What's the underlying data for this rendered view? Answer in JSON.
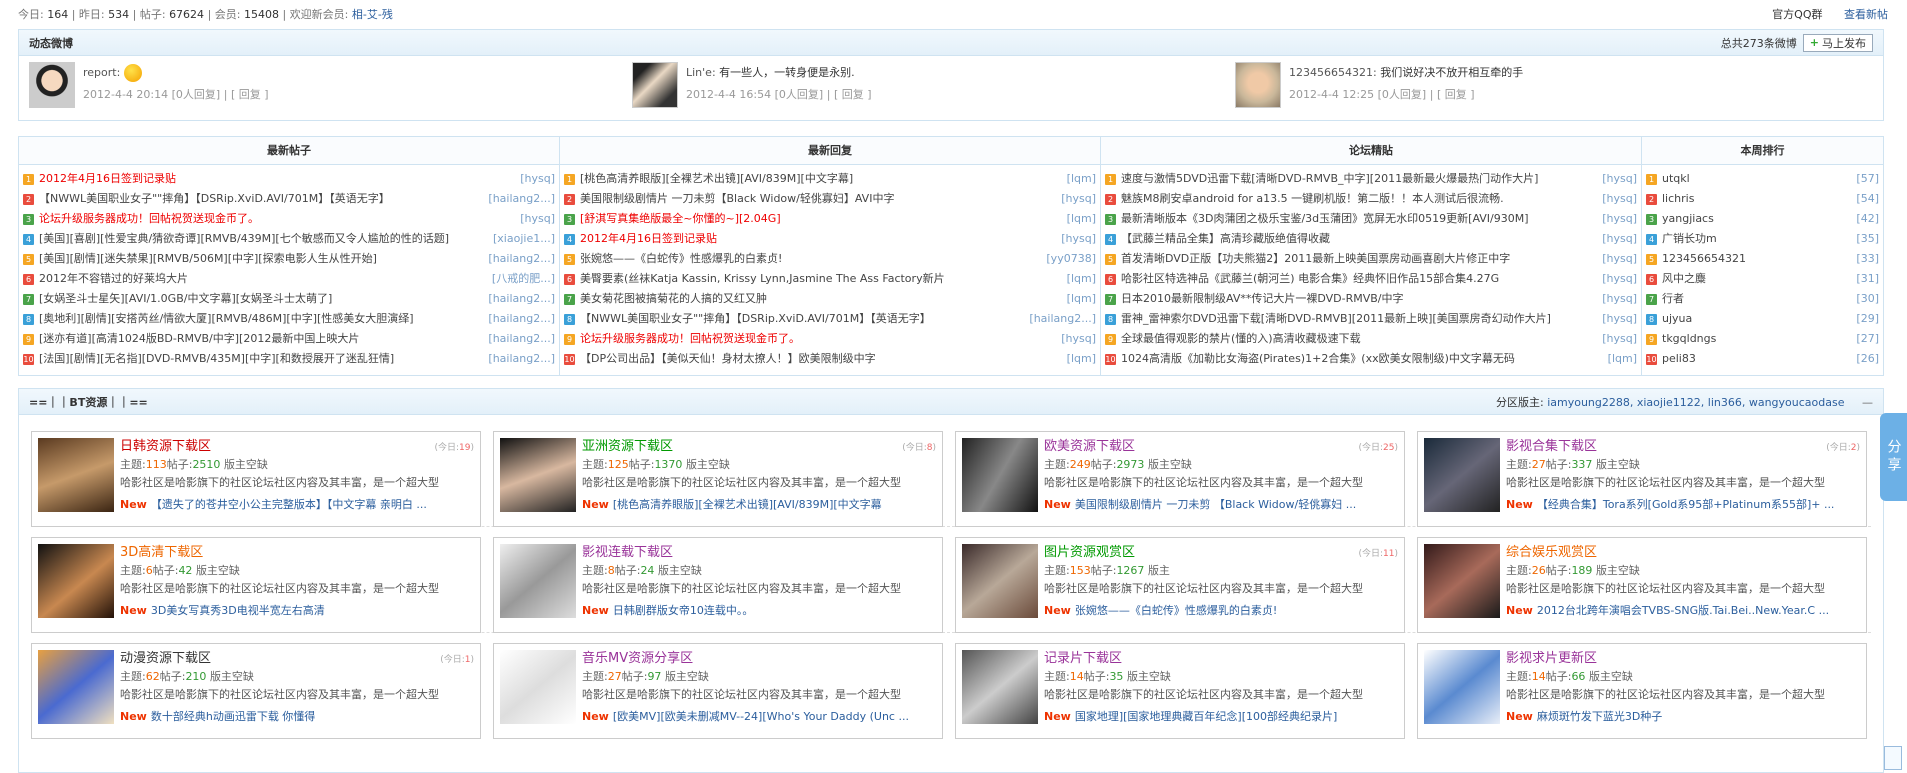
{
  "topbar": {
    "today_label": "今日:",
    "today": "164",
    "yesterday_label": "昨日:",
    "yesterday": "534",
    "posts_label": "帖子:",
    "posts": "67624",
    "members_label": "会员:",
    "members": "15408",
    "welcome_label": "欢迎新会员:",
    "new_member": "相-艾-残",
    "qq_group": "官方QQ群",
    "view_new": "查看新帖"
  },
  "feed": {
    "title": "动态微博",
    "total": "总共273条微博",
    "publish": "马上发布",
    "items": [
      {
        "user": "report:",
        "text": "",
        "time": "2012-4-4 20:14",
        "replies": "[0人回复]",
        "reply": "[ 回复 ]"
      },
      {
        "user": "Lin'e:",
        "text": "有一些人，一转身便是永别.",
        "time": "2012-4-4 16:54",
        "replies": "[0人回复]",
        "reply": "[ 回复 ]"
      },
      {
        "user": "123456654321:",
        "text": "我们说好决不放开相互牵的手",
        "time": "2012-4-4 12:25",
        "replies": "[0人回复]",
        "reply": "[ 回复 ]"
      }
    ]
  },
  "columns": [
    {
      "title": "最新帖子",
      "items": [
        {
          "t": "2012年4月16日签到记录贴",
          "a": "[hysq]",
          "red": true
        },
        {
          "t": "【NWWL美国职业女子\"\"摔角】【DSRip.XviD.AVI/701M】【英语无字】",
          "a": "[hailang2...]",
          "red": false
        },
        {
          "t": "论坛升级服务器成功！回帖祝贺送现金币了。",
          "a": "[hysq]",
          "red": true
        },
        {
          "t": "[美国][喜剧][性爱宝典/猜欲奇谭][RMVB/439M][七个敏感而又令人尴尬的性的话题]",
          "a": "[xiaojie1...]",
          "red": false
        },
        {
          "t": "[美国][剧情][迷失禁果][RMVB/506M][中字][探索电影人生从性开始]",
          "a": "[hailang2...]",
          "red": false
        },
        {
          "t": "2012年不容错过的好莱坞大片",
          "a": "[八戒的肥...]",
          "red": false
        },
        {
          "t": "[女娲圣斗士星矢][AVI/1.0GB/中文字幕][女娲圣斗士太萌了]",
          "a": "[hailang2...]",
          "red": false
        },
        {
          "t": "[奥地利][剧情][安搭芮丝/情欲大厦][RMVB/486M][中字][性感美女大胆演绎]",
          "a": "[hailang2...]",
          "red": false
        },
        {
          "t": "[迷亦有道][高清1024版BD-RMVB/中字][2012最新中国上映大片",
          "a": "[hailang2...]",
          "red": false
        },
        {
          "t": "[法国][剧情][无名指][DVD-RMVB/435M][中字][和数授展开了迷乱狂情]",
          "a": "[hailang2...]",
          "red": false
        }
      ]
    },
    {
      "title": "最新回复",
      "items": [
        {
          "t": "[桃色高清养眼版][全裸艺术出镜][AVI/839M][中文字幕]",
          "a": "[lqm]",
          "red": false
        },
        {
          "t": "美国限制级剧情片 一刀未剪【Black Widow/轻佻寡妇】AVI中字",
          "a": "[hysq]",
          "red": false
        },
        {
          "t": "[舒淇写真集绝版最全~你懂的~][2.04G]",
          "a": "[lqm]",
          "red": true
        },
        {
          "t": "2012年4月16日签到记录贴",
          "a": "[hysq]",
          "red": true
        },
        {
          "t": "张婉悠——《白蛇传》性感爆乳的白素贞!",
          "a": "[yy0738]",
          "red": false
        },
        {
          "t": "美臀要素(丝袜Katja Kassin, Krissy Lynn,Jasmine The Ass Factory新片",
          "a": "[lqm]",
          "red": false
        },
        {
          "t": "美女菊花图被搞菊花的人搞的又红又肿",
          "a": "[lqm]",
          "red": false
        },
        {
          "t": "【NWWL美国职业女子\"\"摔角】【DSRip.XviD.AVI/701M】【英语无字】",
          "a": "[hailang2...]",
          "red": false
        },
        {
          "t": "论坛升级服务器成功！回帖祝贺送现金币了。",
          "a": "[hysq]",
          "red": true
        },
        {
          "t": "【DP公司出品】【美似天仙！身材太撩人！】欧美限制级中字",
          "a": "[lqm]",
          "red": false
        }
      ]
    },
    {
      "title": "论坛精貼",
      "items": [
        {
          "t": "速度与激情5DVD迅雷下载[清晰DVD-RMVB_中字][2011最新最火爆最热门动作大片]",
          "a": "[hysq]",
          "red": false
        },
        {
          "t": "魅族M8刷安卓android for a13.5 一键刷机版！第二版！！本人测试后很流畅.",
          "a": "[hysq]",
          "red": false
        },
        {
          "t": "最新清晰版本《3D肉蒲团之极乐宝鉴/3d玉蒲团》宽屏无水印0519更新[AVI/930M]",
          "a": "[hysq]",
          "red": false
        },
        {
          "t": "【武藤兰精品全集】高清珍藏版绝值得收藏",
          "a": "[hysq]",
          "red": false
        },
        {
          "t": "首发清晰DVD正版【功夫熊猫2】2011最新上映美国票房动画喜剧大片修正中字",
          "a": "[hysq]",
          "red": false
        },
        {
          "t": "哈影社区特选神品《武藤兰(朝河兰) 电影合集》经典怀旧作品15部合集4.27G",
          "a": "[hysq]",
          "red": false
        },
        {
          "t": "日本2010最新限制级AV**传记大片一裸DVD-RMVB/中字",
          "a": "[hysq]",
          "red": false
        },
        {
          "t": "雷神_雷神索尔DVD迅雷下载[清晰DVD-RMVB][2011最新上映][美国票房奇幻动作大片]",
          "a": "[hysq]",
          "red": false
        },
        {
          "t": "全球最值得观影的禁片(懂的入)高清收藏极速下载",
          "a": "[hysq]",
          "red": false
        },
        {
          "t": "1024高清版《加勒比女海盗(Pirates)1+2合集》(xx欧美女限制级)中文字幕无码",
          "a": "[lqm]",
          "red": false
        }
      ]
    },
    {
      "title": "本周排行",
      "items": [
        {
          "t": "utqkl",
          "a": "[57]",
          "red": false
        },
        {
          "t": "lichris",
          "a": "[54]",
          "red": false
        },
        {
          "t": "yangjiacs",
          "a": "[42]",
          "red": false
        },
        {
          "t": "广销长功m",
          "a": "[35]",
          "red": false
        },
        {
          "t": "123456654321",
          "a": "[33]",
          "red": false
        },
        {
          "t": "风中之麋",
          "a": "[31]",
          "red": false
        },
        {
          "t": "行者",
          "a": "[30]",
          "red": false
        },
        {
          "t": "ujyua",
          "a": "[29]",
          "red": false
        },
        {
          "t": "tkgqldngs",
          "a": "[27]",
          "red": false
        },
        {
          "t": "peli83",
          "a": "[26]",
          "red": false
        }
      ]
    }
  ],
  "bt": {
    "title": "==｜｜BT资源｜｜==",
    "mods_label": "分区版主:",
    "mods": "iamyoung2288, xiaojie1122, lin366, wangyoucaodase",
    "collapse": "—",
    "cards": [
      {
        "name": "日韩资源下载区",
        "color": "#cc0000",
        "count_pre": "(今日:",
        "count": "19",
        "count_post": ")",
        "topics": "113",
        "posts": "2510",
        "mod": "版主空缺",
        "desc": "哈影社区是哈影旗下的社区论坛社区内容及其丰富，是一个超大型",
        "new": "【遗失了的苍井空小公主完整版本】【中文字幕 亲明白 ..."
      },
      {
        "name": "亚洲资源下载区",
        "color": "#009900",
        "count_pre": "(今日:",
        "count": "8",
        "count_post": ")",
        "topics": "125",
        "posts": "1370",
        "mod": "版主空缺",
        "desc": "哈影社区是哈影旗下的社区论坛社区内容及其丰富，是一个超大型",
        "new": "[桃色高清养眼版][全裸艺术出镜][AVI/839M][中文字幕"
      },
      {
        "name": "欧美资源下载区",
        "color": "#993399",
        "count_pre": "(今日:",
        "count": "25",
        "count_post": ")",
        "topics": "249",
        "posts": "2973",
        "mod": "版主空缺",
        "desc": "哈影社区是哈影旗下的社区论坛社区内容及其丰富，是一个超大型",
        "new": "美国限制级剧情片 一刀未剪 【Black Widow/轻佻寡妇 ..."
      },
      {
        "name": "影视合集下载区",
        "color": "#993399",
        "count_pre": "(今日:",
        "count": "2",
        "count_post": ")",
        "topics": "27",
        "posts": "337",
        "mod": "版主空缺",
        "desc": "哈影社区是哈影旗下的社区论坛社区内容及其丰富，是一个超大型",
        "new": "【经典合集】Tora系列[Gold系95部+Platinum系55部]+ ..."
      },
      {
        "name": "3D高清下载区",
        "color": "#ee6600",
        "count_pre": "",
        "count": "",
        "count_post": "",
        "topics": "6",
        "posts": "42",
        "mod": "版主空缺",
        "desc": "哈影社区是哈影旗下的社区论坛社区内容及其丰富，是一个超大型",
        "new": "3D美女写真秀3D电视半宽左右高清"
      },
      {
        "name": "影视连载下载区",
        "color": "#993399",
        "count_pre": "",
        "count": "",
        "count_post": "",
        "topics": "8",
        "posts": "24",
        "mod": "版主空缺",
        "desc": "哈影社区是哈影旗下的社区论坛社区内容及其丰富，是一个超大型",
        "new": "日韩剧群版女帝10连载中。。"
      },
      {
        "name": "图片资源观赏区",
        "color": "#009900",
        "count_pre": "(今日:",
        "count": "11",
        "count_post": ")",
        "topics": "153",
        "posts": "1267",
        "mod": "版主",
        "desc": "哈影社区是哈影旗下的社区论坛社区内容及其丰富，是一个超大型",
        "new": "张婉悠——《白蛇传》性感爆乳的白素贞!"
      },
      {
        "name": "综合娱乐观赏区",
        "color": "#ee6600",
        "count_pre": "",
        "count": "",
        "count_post": "",
        "topics": "26",
        "posts": "189",
        "mod": "版主空缺",
        "desc": "哈影社区是哈影旗下的社区论坛社区内容及其丰富，是一个超大型",
        "new": "2012台北跨年演唱会TVBS-SNG版.Tai.Bei..New.Year.C ..."
      },
      {
        "name": "动漫资源下载区",
        "color": "#333333",
        "count_pre": "(今日:",
        "count": "1",
        "count_post": ")",
        "topics": "62",
        "posts": "210",
        "mod": "版主空缺",
        "desc": "哈影社区是哈影旗下的社区论坛社区内容及其丰富，是一个超大型",
        "new": "数十部经典h动画迅雷下载 你懂得"
      },
      {
        "name": "音乐MV资源分享区",
        "color": "#993399",
        "count_pre": "",
        "count": "",
        "count_post": "",
        "topics": "27",
        "posts": "97",
        "mod": "版主空缺",
        "desc": "哈影社区是哈影旗下的社区论坛社区内容及其丰富，是一个超大型",
        "new": "[欧美MV][欧美未删减MV--24][Who's Your Daddy (Unc ..."
      },
      {
        "name": "记录片下载区",
        "color": "#993399",
        "count_pre": "",
        "count": "",
        "count_post": "",
        "topics": "14",
        "posts": "35",
        "mod": "版主空缺",
        "desc": "哈影社区是哈影旗下的社区论坛社区内容及其丰富，是一个超大型",
        "new": "国家地理][国家地理典藏百年纪念][100部经典纪录片]"
      },
      {
        "name": "影视求片更新区",
        "color": "#993399",
        "count_pre": "",
        "count": "",
        "count_post": "",
        "topics": "14",
        "posts": "66",
        "mod": "版主空缺",
        "desc": "哈影社区是哈影旗下的社区论坛社区内容及其丰富，是一个超大型",
        "new": "麻烦斑竹发下蓝光3D种子"
      }
    ],
    "topic_label": "主题:",
    "posts_label": "帖子:",
    "new_label": "New"
  },
  "share": "分享",
  "num_colors": [
    "#f5a623",
    "#e94c3d",
    "#4aa34a",
    "#3aa0d8"
  ]
}
